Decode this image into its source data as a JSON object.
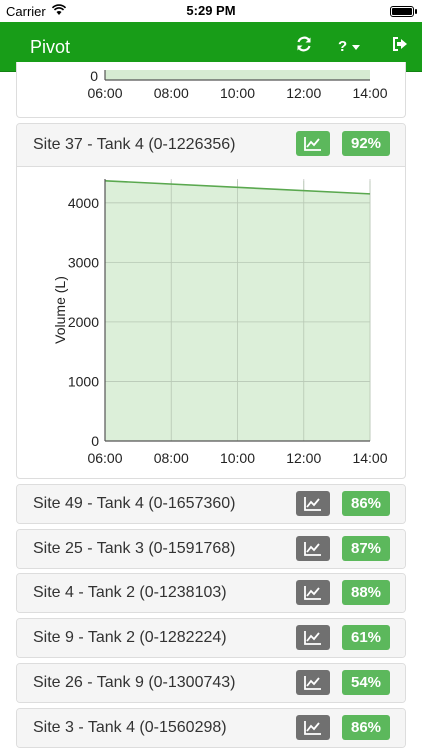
{
  "status_bar": {
    "carrier": "Carrier",
    "time": "5:29 PM"
  },
  "navbar": {
    "brand": "Pivot",
    "help_label": "?"
  },
  "top_partial_chart": {
    "x_ticks": [
      "06:00",
      "08:00",
      "10:00",
      "12:00",
      "14:00"
    ],
    "y_tick_visible": "0"
  },
  "expanded_panel": {
    "title": "Site 37 - Tank 4 (0-1226356)",
    "percent": "92%",
    "chart_data": {
      "type": "area",
      "ylabel": "Volume (L)",
      "xlabel": "",
      "x_ticks": [
        "06:00",
        "08:00",
        "10:00",
        "12:00",
        "14:00"
      ],
      "y_ticks": [
        "0",
        "1000",
        "2000",
        "3000",
        "4000"
      ],
      "ylim": [
        0,
        4400
      ],
      "x": [
        "06:00",
        "14:00"
      ],
      "series": [
        {
          "values": [
            4370,
            4150
          ]
        }
      ],
      "grid": true,
      "colors": {
        "line": "#5aa84f",
        "fill": "#d6ecd2",
        "grid": "#cfcfcf"
      }
    }
  },
  "tank_panels": [
    {
      "title": "Site 49 - Tank 4 (0-1657360)",
      "percent": "86%"
    },
    {
      "title": "Site 25 - Tank 3 (0-1591768)",
      "percent": "87%"
    },
    {
      "title": "Site 4 - Tank 2 (0-1238103)",
      "percent": "88%"
    },
    {
      "title": "Site 9 - Tank 2 (0-1282224)",
      "percent": "61%"
    },
    {
      "title": "Site 26 - Tank 9 (0-1300743)",
      "percent": "54%"
    },
    {
      "title": "Site 3 - Tank 4 (0-1560298)",
      "percent": "86%"
    }
  ],
  "colors": {
    "nav_green": "#189d18",
    "badge_green": "#5cb85c",
    "button_gray": "#707070"
  }
}
